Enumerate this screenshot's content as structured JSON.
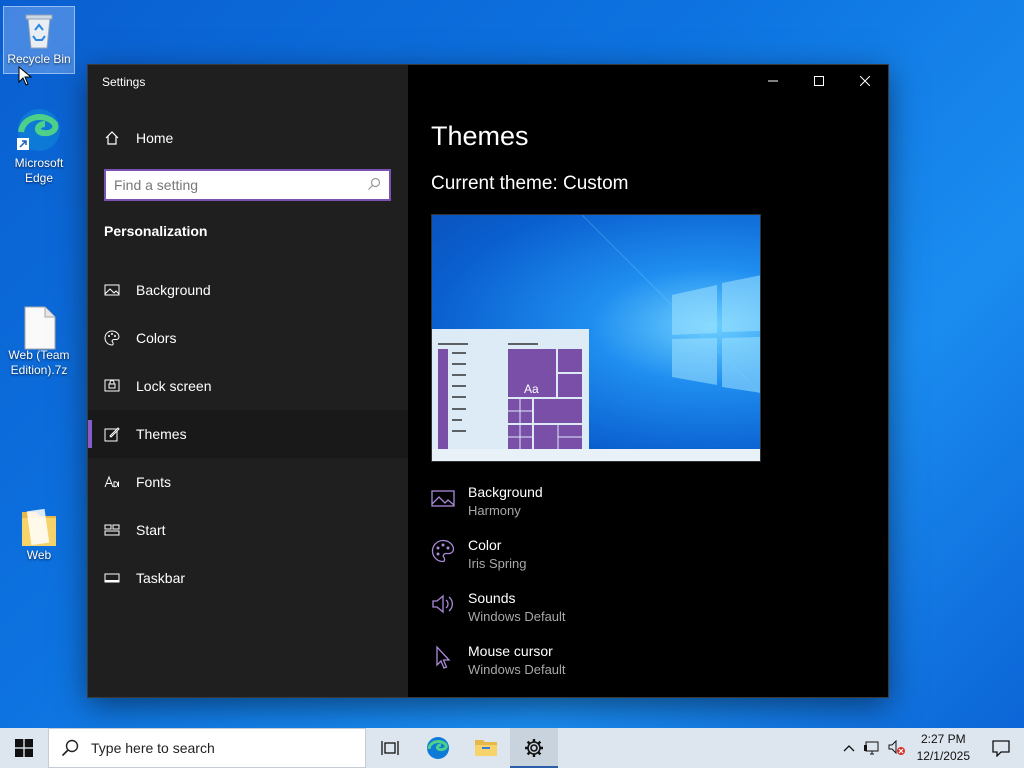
{
  "desktop": {
    "icons": [
      {
        "label": "Recycle Bin"
      },
      {
        "label": "Microsoft Edge"
      },
      {
        "label": "Web (Team Edition).7z"
      },
      {
        "label": "Web"
      }
    ]
  },
  "window": {
    "title": "Settings",
    "home_label": "Home",
    "search": {
      "placeholder": "Find a setting",
      "value": ""
    },
    "section_title": "Personalization",
    "nav": [
      {
        "label": "Background",
        "icon": "picture-icon"
      },
      {
        "label": "Colors",
        "icon": "palette-icon"
      },
      {
        "label": "Lock screen",
        "icon": "lock-screen-icon"
      },
      {
        "label": "Themes",
        "icon": "brush-icon",
        "active": true
      },
      {
        "label": "Fonts",
        "icon": "fonts-icon"
      },
      {
        "label": "Start",
        "icon": "start-icon"
      },
      {
        "label": "Taskbar",
        "icon": "taskbar-icon"
      }
    ],
    "accent_color": "#8a5cc9"
  },
  "content": {
    "page_title": "Themes",
    "current_theme": "Current theme: Custom",
    "preview_tile_label": "Aa",
    "items": [
      {
        "name": "Background",
        "value": "Harmony"
      },
      {
        "name": "Color",
        "value": "Iris Spring"
      },
      {
        "name": "Sounds",
        "value": "Windows Default"
      },
      {
        "name": "Mouse cursor",
        "value": "Windows Default"
      }
    ]
  },
  "taskbar": {
    "search_placeholder": "Type here to search",
    "time": "2:27 PM",
    "date": "12/1/2025"
  }
}
